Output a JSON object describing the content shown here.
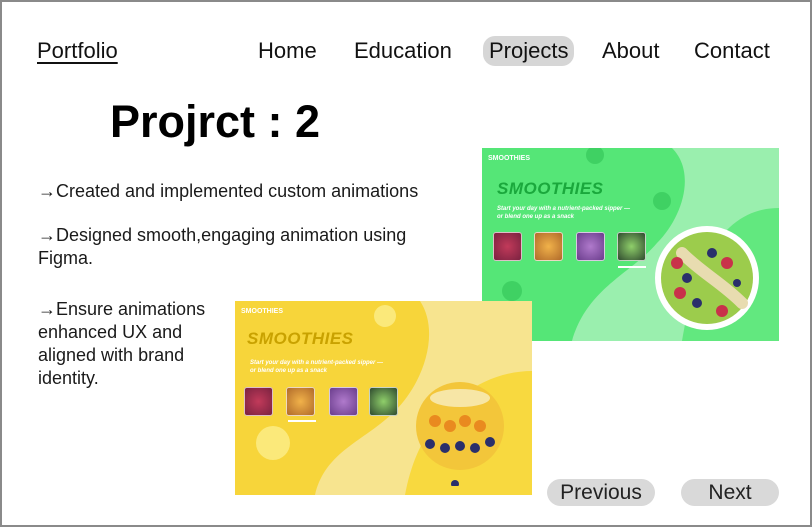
{
  "header": {
    "logo": "Portfolio",
    "nav": [
      "Home",
      "Education",
      "Projects",
      "About",
      "Contact"
    ]
  },
  "main": {
    "title": "Projrct : 2",
    "bullets": [
      "→Created and implemented custom animations",
      "→Designed smooth,engaging animation using Figma.",
      "→Ensure animations enhanced UX and aligned with brand identity."
    ]
  },
  "previews": {
    "green": {
      "brand": "SMOOTHIES",
      "heading": "SMOOTHIES",
      "subtitle": "Start your day with a nutrient-packed sipper — or blend one up as a snack"
    },
    "yellow": {
      "brand": "SMOOTHIES",
      "heading": "SMOOTHIES",
      "subtitle": "Start your day with a nutrient-packed sipper — or blend one up as a snack"
    }
  },
  "pager": {
    "previous": "Previous",
    "next": "Next"
  },
  "colors": {
    "active_nav": "#d6d6d6",
    "button": "#d9d9d9",
    "green_bg": "#55e677",
    "yellow_bg": "#f7e48f"
  }
}
